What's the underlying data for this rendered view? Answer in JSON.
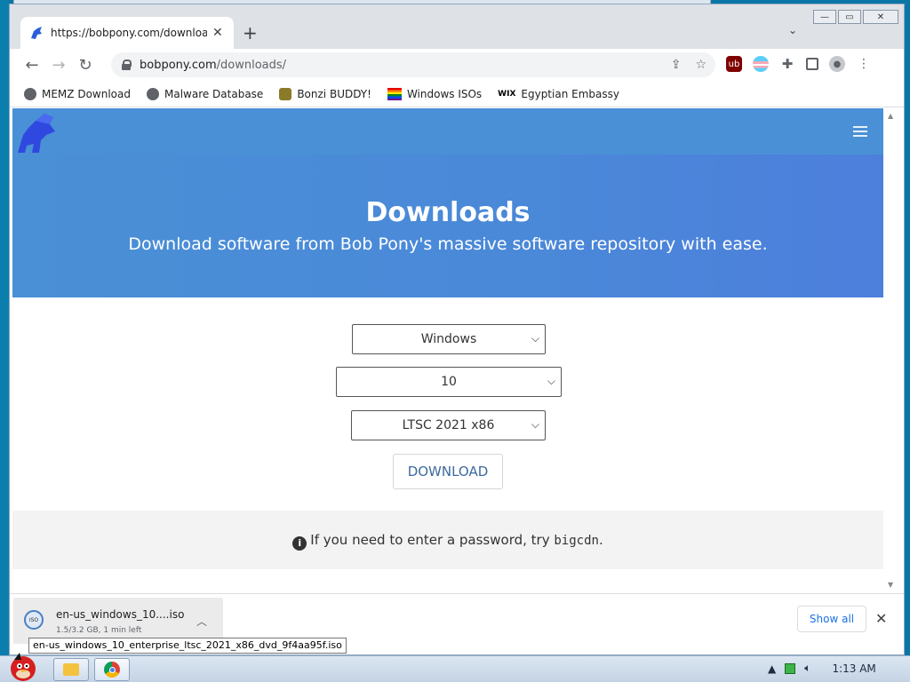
{
  "browser": {
    "tab_title": "https://bobpony.com/downloads/",
    "tab_close": "✕",
    "new_tab": "+",
    "url_domain": "bobpony.com",
    "url_path": "/downloads/",
    "win_minimize": "—",
    "win_maximize": "▭",
    "win_close": "✕"
  },
  "bookmarks": [
    {
      "label": "MEMZ Download",
      "icon": "globe-icon"
    },
    {
      "label": "Malware Database",
      "icon": "globe-icon"
    },
    {
      "label": "Bonzi BUDDY!",
      "icon": "bonzi-icon"
    },
    {
      "label": "Windows ISOs",
      "icon": "rainbow-flag-icon"
    },
    {
      "label": "Egyptian Embassy",
      "icon": "wix-icon",
      "icon_text": "WIX"
    }
  ],
  "page": {
    "hero_title": "Downloads",
    "hero_subtitle": "Download software from Bob Pony's massive software repository with ease.",
    "select_os": "Windows",
    "select_version": "10",
    "select_edition": "LTSC 2021 x86",
    "download_label": "DOWNLOAD",
    "info_prefix": "If you need to enter a password, try",
    "info_password": "bigcdn",
    "info_suffix": "."
  },
  "downloads_shelf": {
    "file_name": "en-us_windows_10....iso",
    "icon_text": "ISO",
    "status": "1.5/3.2 GB, 1 min left",
    "show_all": "Show all",
    "close": "✕",
    "tooltip": "en-us_windows_10_enterprise_ltsc_2021_x86_dvd_9f4aa95f.iso"
  },
  "taskbar": {
    "clock": "1:13 AM"
  },
  "colors": {
    "hero_blue": "#4a90d6",
    "link_blue": "#1a73e8",
    "download_text": "#3d6a9e"
  }
}
